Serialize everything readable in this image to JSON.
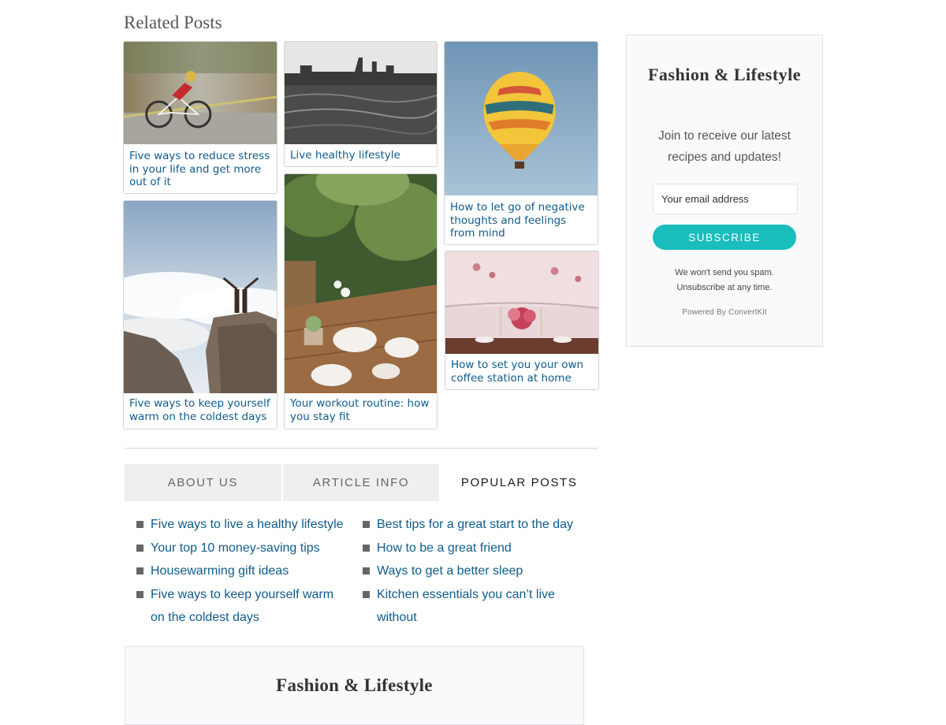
{
  "related": {
    "title": "Related Posts",
    "posts": [
      {
        "title": "Five ways to reduce stress in your life and get more out of it",
        "image": "cyclist-photo"
      },
      {
        "title": "Live healthy lifestyle",
        "image": "city-skyline-water-photo"
      },
      {
        "title": "How to let go of negative thoughts and feelings from mind",
        "image": "hot-air-balloon-photo"
      },
      {
        "title": "Five ways to keep yourself warm on the coldest days",
        "image": "mountain-clouds-couple-photo"
      },
      {
        "title": "Your workout routine: how you stay fit",
        "image": "garden-table-tea-photo"
      },
      {
        "title": "How to set you your own coffee station at home",
        "image": "dinner-table-flowers-photo"
      }
    ]
  },
  "tabs": [
    {
      "label": "ABOUT US",
      "active": false
    },
    {
      "label": "ARTICLE INFO",
      "active": false
    },
    {
      "label": "POPULAR POSTS",
      "active": true
    }
  ],
  "popular": {
    "col1": [
      "Five ways to live a healthy lifestyle",
      "Your top 10 money-saving tips",
      "Housewarming gift ideas",
      "Five ways to keep yourself warm on the coldest days"
    ],
    "col2": [
      "Best tips for a great start to the day",
      "How to be a great friend",
      "Ways to get a better sleep",
      "Kitchen essentials you can’t live without"
    ]
  },
  "sidebar": {
    "title": "Fashion & Lifestyle",
    "description": "Join to receive our latest recipes and updates!",
    "email_placeholder": "Your email address",
    "subscribe_label": "SUBSCRIBE",
    "spam_line1": "We won't send you spam.",
    "spam_line2": "Unsubscribe at any time.",
    "powered_by": "Powered By ConvertKit"
  },
  "bottom_box": {
    "title": "Fashion & Lifestyle"
  },
  "colors": {
    "link": "#0f5b8a",
    "accent": "#18bdbc",
    "tab_bg": "#efefef"
  }
}
